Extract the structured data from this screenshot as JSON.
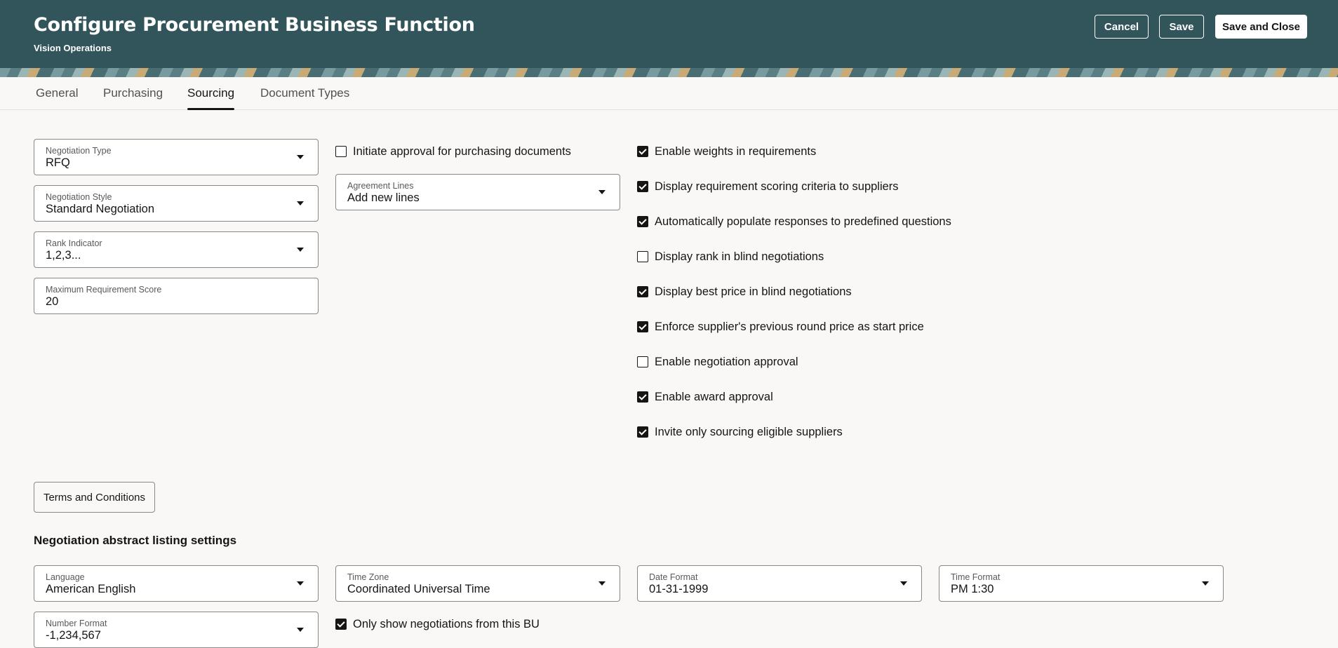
{
  "header": {
    "title": "Configure Procurement Business Function",
    "subtitle": "Vision Operations",
    "cancel_label": "Cancel",
    "save_label": "Save",
    "save_close_label": "Save and Close"
  },
  "tabs": [
    {
      "label": "General",
      "active": false
    },
    {
      "label": "Purchasing",
      "active": false
    },
    {
      "label": "Sourcing",
      "active": true
    },
    {
      "label": "Document Types",
      "active": false
    }
  ],
  "fields": {
    "negotiation_type": {
      "label": "Negotiation Type",
      "value": "RFQ"
    },
    "negotiation_style": {
      "label": "Negotiation Style",
      "value": "Standard Negotiation"
    },
    "rank_indicator": {
      "label": "Rank Indicator",
      "value": "1,2,3..."
    },
    "max_requirement_score": {
      "label": "Maximum Requirement Score",
      "value": "20"
    },
    "agreement_lines": {
      "label": "Agreement Lines",
      "value": "Add new lines"
    }
  },
  "initiate_approval": {
    "label": "Initiate approval for purchasing documents",
    "checked": false
  },
  "options": [
    {
      "label": "Enable weights in requirements",
      "checked": true
    },
    {
      "label": "Display requirement scoring criteria to suppliers",
      "checked": true
    },
    {
      "label": "Automatically populate responses to predefined questions",
      "checked": true
    },
    {
      "label": "Display rank in blind negotiations",
      "checked": false
    },
    {
      "label": "Display best price in blind negotiations",
      "checked": true
    },
    {
      "label": "Enforce supplier's previous round price as start price",
      "checked": true
    },
    {
      "label": "Enable negotiation approval",
      "checked": false
    },
    {
      "label": "Enable award approval",
      "checked": true
    },
    {
      "label": "Invite only sourcing eligible suppliers",
      "checked": true
    }
  ],
  "terms_button": "Terms and Conditions",
  "abstract": {
    "title": "Negotiation abstract listing settings",
    "language": {
      "label": "Language",
      "value": "American English"
    },
    "time_zone": {
      "label": "Time Zone",
      "value": "Coordinated Universal Time"
    },
    "date_format": {
      "label": "Date Format",
      "value": "01-31-1999"
    },
    "time_format": {
      "label": "Time Format",
      "value": "PM 1:30"
    },
    "number_format": {
      "label": "Number Format",
      "value": "-1,234,567"
    },
    "only_bu": {
      "label": "Only show negotiations from this BU",
      "checked": true
    }
  }
}
